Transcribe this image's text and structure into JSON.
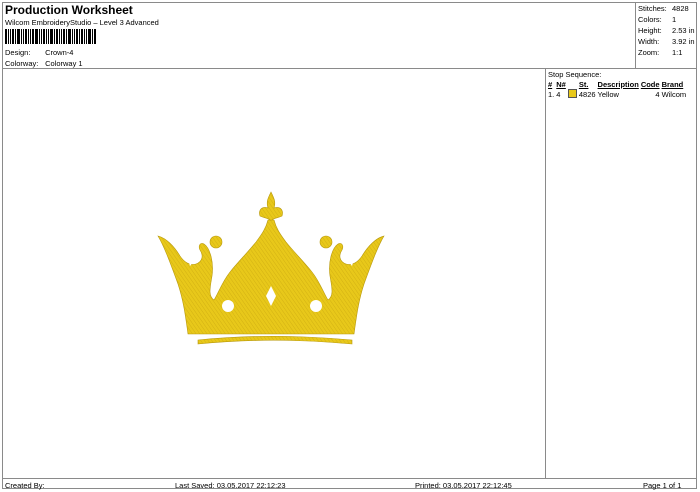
{
  "header": {
    "title": "Production Worksheet",
    "subtitle": "Wilcom EmbroideryStudio – Level 3 Advanced",
    "design_label": "Design:",
    "design_value": "Crown-4",
    "colorway_label": "Colorway:",
    "colorway_value": "Colorway 1"
  },
  "stats": [
    {
      "label": "Stitches:",
      "value": "4828"
    },
    {
      "label": "Colors:",
      "value": "1"
    },
    {
      "label": "Height:",
      "value": "2.53 in"
    },
    {
      "label": "Width:",
      "value": "3.92 in"
    },
    {
      "label": "Zoom:",
      "value": "1:1"
    }
  ],
  "stop_sequence": {
    "title": "Stop Sequence:",
    "columns": {
      "num": "#",
      "needle": "N#",
      "st": "St.",
      "description": "Description",
      "code": "Code",
      "brand": "Brand"
    },
    "rows": [
      {
        "num": "1.",
        "needle": "4",
        "color": "#e8c81a",
        "st": "4826",
        "description": "Yellow",
        "code": "4",
        "brand": "Wilcom"
      }
    ]
  },
  "design_preview": {
    "icon": "crown-embroidery",
    "thread_color": "#e8c81a"
  },
  "footer": {
    "created_by": "Created By:",
    "last_saved": "Last Saved: 03.05.2017 22:12:23",
    "printed": "Printed: 03.05.2017 22:12:45",
    "page": "Page 1 of 1"
  }
}
